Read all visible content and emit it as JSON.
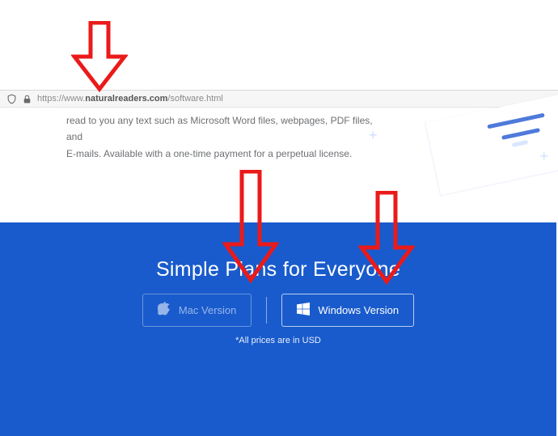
{
  "browser": {
    "url_prefix": "https://www.",
    "url_host": "naturalreaders.com",
    "url_path": "/software.html"
  },
  "intro": {
    "line1": "read to you any text such as Microsoft Word files, webpages, PDF files, and",
    "line2": "E-mails. Available with a one-time payment for a perpetual license."
  },
  "plans": {
    "title": "Simple Plans for Everyone",
    "mac_label": "Mac Version",
    "windows_label": "Windows Version",
    "price_note": "*All prices are in USD"
  },
  "icons": {
    "shield": "shield-icon",
    "lock": "lock-icon",
    "apple": "apple-icon",
    "windows": "windows-icon"
  },
  "colors": {
    "blue_section": "#195bcc",
    "annotation_red": "#eb1a1a"
  }
}
